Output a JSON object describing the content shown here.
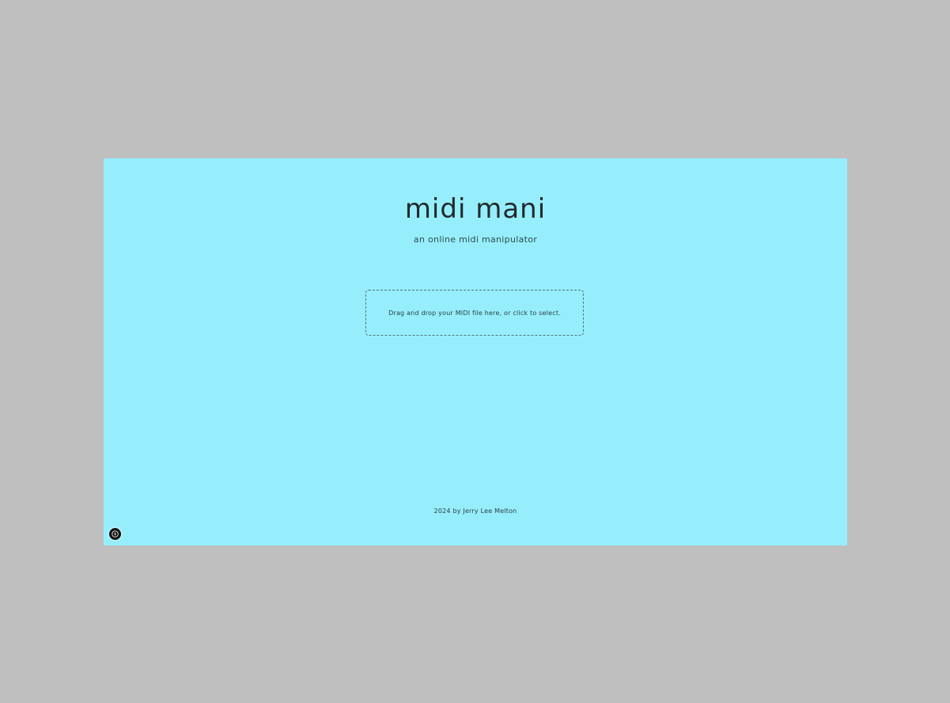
{
  "page": {
    "title": "midi mani",
    "subtitle": "an online midi manipulator"
  },
  "upload": {
    "prompt": "Drag and drop your MIDI file here, or click to select."
  },
  "footer": {
    "text": "2024 by Jerry Lee Melton"
  },
  "badge": {
    "icon": "lightning-bolt-icon"
  },
  "colors": {
    "background": "#96eefc",
    "outer_background": "#bfbfbf",
    "text": "#222a2c",
    "dropzone_border": "#56707a",
    "badge": "#111111"
  }
}
